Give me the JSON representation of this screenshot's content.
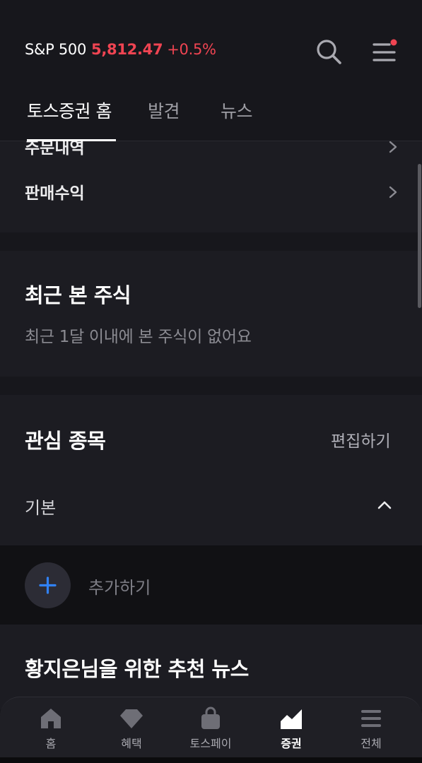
{
  "header": {
    "ticker_name": "S&P 500",
    "ticker_price": "5,812.47",
    "ticker_change": "+0.5%",
    "colors": {
      "up": "#f04452",
      "background": "#17171c"
    },
    "icons": [
      "search-icon",
      "menu-icon",
      "notification-dot"
    ]
  },
  "tabs": [
    {
      "label": "토스증권 홈",
      "active": true
    },
    {
      "label": "발견",
      "active": false
    },
    {
      "label": "뉴스",
      "active": false
    }
  ],
  "list": {
    "items": [
      {
        "label": "주문내역"
      },
      {
        "label": "판매수익"
      }
    ]
  },
  "recent": {
    "title": "최근 본 주식",
    "empty_text": "최근 1달 이내에 본 주식이 없어요"
  },
  "watchlist": {
    "title": "관심 종목",
    "edit_label": "편집하기",
    "group_label": "기본",
    "add_label": "추가하기",
    "colors": {
      "add_icon": "#3182f6"
    }
  },
  "news": {
    "title": "황지은님을 위한 추천 뉴스"
  },
  "bottom_nav": {
    "items": [
      {
        "label": "홈",
        "icon": "home-icon",
        "active": false
      },
      {
        "label": "혜택",
        "icon": "diamond-icon",
        "active": false
      },
      {
        "label": "토스페이",
        "icon": "shopping-bag-icon",
        "active": false
      },
      {
        "label": "증권",
        "icon": "stock-chart-icon",
        "active": true
      },
      {
        "label": "전체",
        "icon": "menu-icon",
        "active": false
      }
    ]
  }
}
